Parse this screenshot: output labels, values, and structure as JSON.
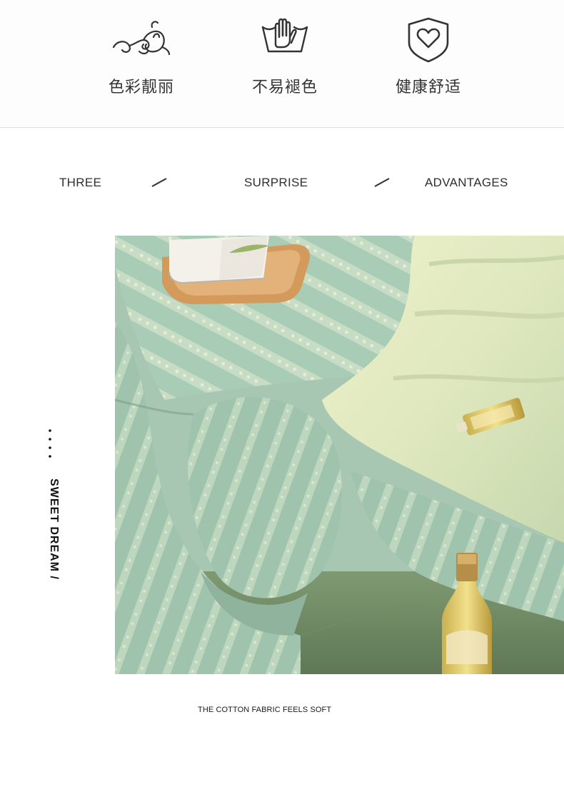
{
  "features": [
    {
      "icon": "flourish-icon",
      "label": "色彩靓丽"
    },
    {
      "icon": "hand-wash-icon",
      "label": "不易褪色"
    },
    {
      "icon": "heart-shield-icon",
      "label": "健康舒适"
    }
  ],
  "tagline": {
    "word1": "THREE",
    "word2": "SURPRISE",
    "word3": "ADVANTAGES"
  },
  "side_label": {
    "text": "SWEET DREAM  /"
  },
  "caption": "THE COTTON FABRIC FEELS SOFT",
  "colors": {
    "text": "#333333",
    "divider": "#dcdcdc",
    "sheet_green": "#9fc4ae",
    "sheet_light": "#dfe8c6",
    "tray_wood": "#d49a5c"
  }
}
